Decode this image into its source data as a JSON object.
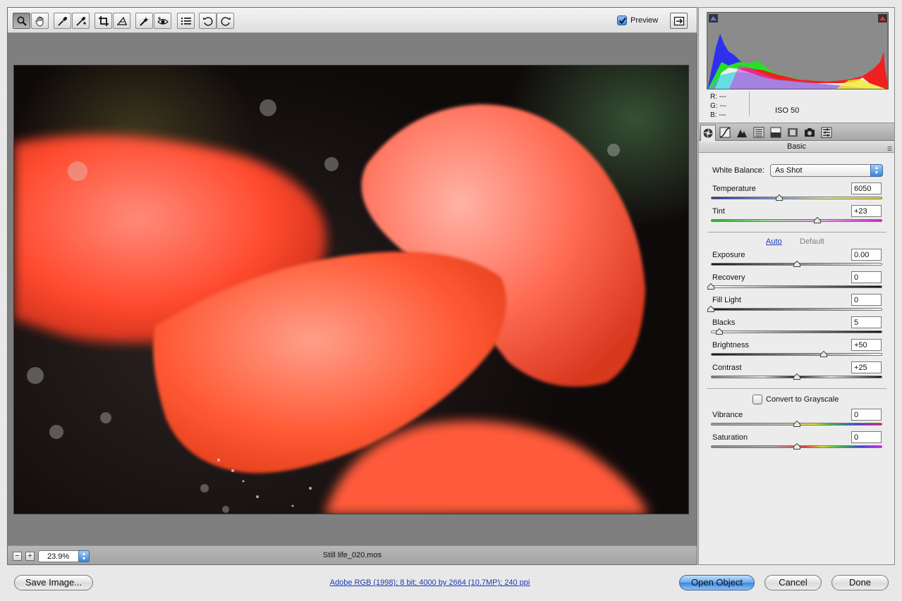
{
  "toolbar": {
    "tools": [
      {
        "name": "zoom-tool",
        "icon": "magnifier-icon",
        "active": true
      },
      {
        "name": "hand-tool",
        "icon": "hand-icon",
        "active": false
      },
      {
        "name": "white-balance-tool",
        "icon": "eyedropper-icon",
        "active": false
      },
      {
        "name": "color-sampler-tool",
        "icon": "color-sampler-icon",
        "active": false
      },
      {
        "name": "crop-tool",
        "icon": "crop-icon",
        "active": false
      },
      {
        "name": "straighten-tool",
        "icon": "straighten-icon",
        "active": false
      },
      {
        "name": "retouch-tool",
        "icon": "retouch-icon",
        "active": false
      },
      {
        "name": "red-eye-tool",
        "icon": "red-eye-icon",
        "active": false
      },
      {
        "name": "preferences-tool",
        "icon": "list-icon",
        "active": false
      },
      {
        "name": "rotate-left-tool",
        "icon": "rotate-ccw-icon",
        "active": false
      },
      {
        "name": "rotate-right-tool",
        "icon": "rotate-cw-icon",
        "active": false
      }
    ],
    "preview_label": "Preview",
    "preview_checked": true
  },
  "status": {
    "zoom_minus": "−",
    "zoom_plus": "+",
    "zoom_value": "23.9%",
    "filename": "Still life_020.mos"
  },
  "info": {
    "r_label": "R:",
    "r_value": "---",
    "g_label": "G:",
    "g_value": "---",
    "b_label": "B:",
    "b_value": "---",
    "iso": "ISO 50"
  },
  "panel": {
    "tabs": [
      "basic-tab",
      "tone-curve-tab",
      "detail-tab",
      "hsl-tab",
      "split-toning-tab",
      "lens-corrections-tab",
      "camera-calibration-tab",
      "presets-tab"
    ],
    "section_title": "Basic",
    "white_balance_label": "White Balance:",
    "white_balance_value": "As Shot",
    "auto_label": "Auto",
    "default_label": "Default",
    "grayscale_label": "Convert to Grayscale",
    "grayscale_checked": false,
    "sliders": {
      "temperature": {
        "label": "Temperature",
        "value": "6050",
        "fraction": 0.4
      },
      "tint": {
        "label": "Tint",
        "value": "+23",
        "fraction": 0.62
      },
      "exposure": {
        "label": "Exposure",
        "value": "0.00",
        "fraction": 0.5
      },
      "recovery": {
        "label": "Recovery",
        "value": "0",
        "fraction": 0.0
      },
      "fill_light": {
        "label": "Fill Light",
        "value": "0",
        "fraction": 0.0
      },
      "blacks": {
        "label": "Blacks",
        "value": "5",
        "fraction": 0.05
      },
      "brightness": {
        "label": "Brightness",
        "value": "+50",
        "fraction": 0.66
      },
      "contrast": {
        "label": "Contrast",
        "value": "+25",
        "fraction": 0.5
      },
      "vibrance": {
        "label": "Vibrance",
        "value": "0",
        "fraction": 0.5
      },
      "saturation": {
        "label": "Saturation",
        "value": "0",
        "fraction": 0.5
      }
    }
  },
  "footer": {
    "save_label": "Save Image...",
    "info_link": "Adobe RGB (1998); 8 bit; 4000 by 2664 (10.7MP); 240 ppi",
    "open_label": "Open Object",
    "cancel_label": "Cancel",
    "done_label": "Done"
  },
  "colors": {
    "accent_blue": "#3c84d7",
    "link_blue": "#1a3ab8",
    "histogram_bg": "#8b8b8b",
    "highlight_clip_warning": "#e02020",
    "shadow_clip_warning": "#3a5ad8"
  }
}
